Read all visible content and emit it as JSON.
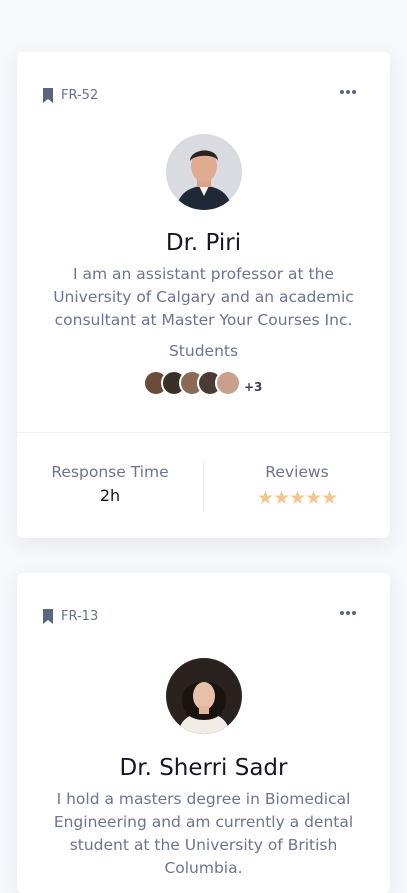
{
  "cards": [
    {
      "tag": "FR-52",
      "name": "Dr. Piri",
      "bio": "I am an assistant professor at the University of Calgary and an academic consultant at Master Your Courses Inc.",
      "students_label": "Students",
      "students_extra": "+3",
      "response_label": "Response Time",
      "response_value": "2h",
      "reviews_label": "Reviews",
      "rating": "★★★★★"
    },
    {
      "tag": "FR-13",
      "name": "Dr. Sherri Sadr",
      "bio": "I hold a masters degree in Biomedical Engineering and am currently a dental student at the University of British Columbia."
    }
  ],
  "colors": {
    "background": "#f7f8fc",
    "card": "#ffffff",
    "muted_text": "#6b7590",
    "star": "#f0c78e"
  },
  "icons": {
    "tag": "bookmark-icon",
    "menu": "more-horizontal-icon"
  }
}
